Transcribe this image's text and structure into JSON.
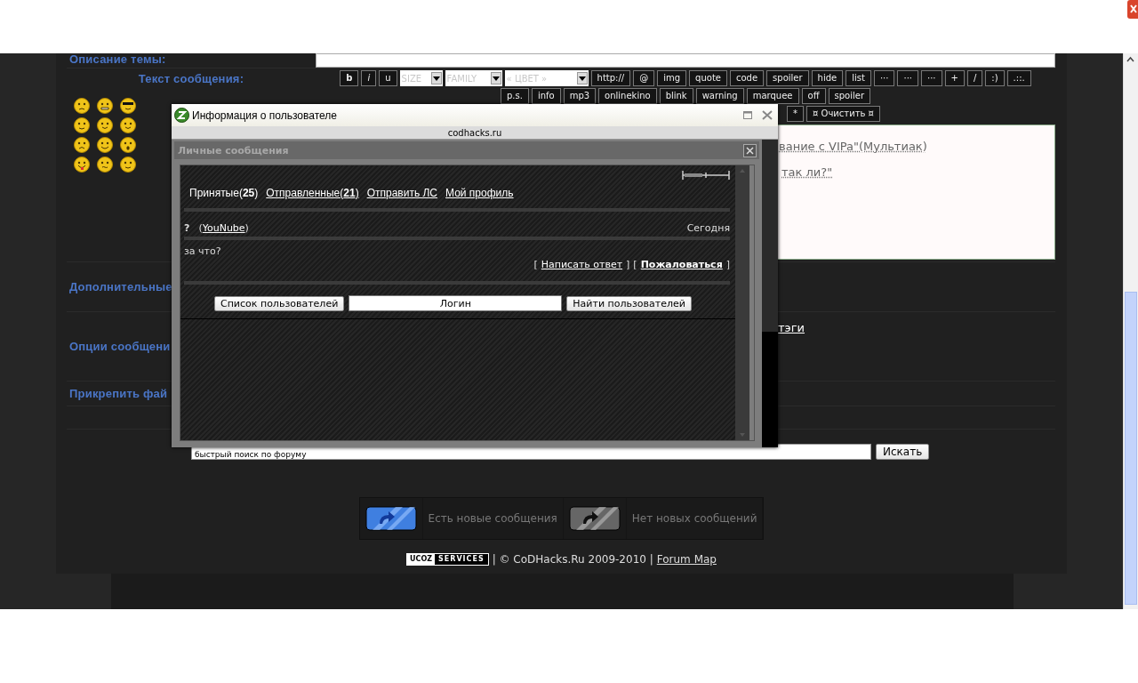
{
  "topic_description": {
    "label": "Описание темы:"
  },
  "message": {
    "label": "Текст сообщения:",
    "smileys": [
      {
        "kind": "angry"
      },
      {
        "kind": "grin"
      },
      {
        "kind": "cool"
      },
      {
        "kind": "eyes"
      },
      {
        "kind": "content"
      },
      {
        "kind": "content"
      },
      {
        "kind": "sad"
      },
      {
        "kind": "smile"
      },
      {
        "kind": "shock"
      },
      {
        "kind": "tongue"
      },
      {
        "kind": "dizzy"
      },
      {
        "kind": "wink"
      }
    ]
  },
  "toolbar": {
    "rows": [
      {
        "items": [
          {
            "kind": "bold",
            "label": "b"
          },
          {
            "kind": "italic",
            "label": "i"
          },
          {
            "kind": "button",
            "label": "u"
          },
          {
            "kind": "select",
            "label": "SIZE"
          },
          {
            "kind": "select",
            "label": "FAMILY"
          },
          {
            "kind": "select",
            "label": "« ЦВЕТ »"
          },
          {
            "kind": "button",
            "label": "http://"
          },
          {
            "kind": "button",
            "label": "@"
          },
          {
            "kind": "button",
            "label": "img"
          },
          {
            "kind": "button",
            "label": "quote"
          },
          {
            "kind": "button",
            "label": "code"
          },
          {
            "kind": "button",
            "label": "spoiler"
          },
          {
            "kind": "button",
            "label": "hide"
          },
          {
            "kind": "button",
            "label": "list"
          },
          {
            "kind": "button",
            "label": "···"
          },
          {
            "kind": "button",
            "label": "···"
          },
          {
            "kind": "button",
            "label": "···"
          },
          {
            "kind": "button",
            "label": "+"
          },
          {
            "kind": "button",
            "label": "/"
          },
          {
            "kind": "button",
            "label": ":)"
          },
          {
            "kind": "button",
            "label": ".::."
          }
        ]
      },
      {
        "items": [
          {
            "kind": "button",
            "label": "p.s."
          },
          {
            "kind": "button",
            "label": "info"
          },
          {
            "kind": "button",
            "label": "mp3"
          },
          {
            "kind": "button",
            "label": "onlinekino"
          },
          {
            "kind": "button",
            "label": "blink"
          },
          {
            "kind": "button",
            "label": "warning"
          },
          {
            "kind": "button",
            "label": "marquee"
          },
          {
            "kind": "button",
            "label": "off"
          },
          {
            "kind": "button",
            "label": "spoiler"
          }
        ]
      },
      {
        "items": [
          {
            "kind": "button",
            "label": "*"
          },
          {
            "kind": "button",
            "label": "¤ Очистить ¤"
          }
        ]
      }
    ]
  },
  "editor": {
    "lines": [
      "вание с VIPa\"(Мультиак)",
      "так ли?\""
    ]
  },
  "sections": [
    {
      "label": "Дополнительные"
    },
    {
      "label": "Опции сообщени",
      "link": "тэги"
    },
    {
      "label": "Прикрепить фай"
    }
  ],
  "search": {
    "value": "быстрый поиск по форуму",
    "button": "Искать"
  },
  "legend": [
    {
      "kind": "new",
      "label": "Есть новые сообщения"
    },
    {
      "kind": "none",
      "label": "Нет новых сообщений"
    }
  ],
  "footer": {
    "badge_left": "UCOZ",
    "badge_right": "SERVICES",
    "text": "| © CoDHacks.Ru 2009-2010 |",
    "link": "Forum Map"
  },
  "popup": {
    "title": "Информация о пользователе",
    "site": "codhacks.ru",
    "panel_title": "Личные сообщения",
    "tabs": [
      {
        "label": "Принятые(**25**)",
        "selected": true
      },
      {
        "label": "Отправленные(**21**)",
        "selected": false
      },
      {
        "label": "Отправить ЛС",
        "selected": false
      },
      {
        "label": "Мой профиль",
        "selected": false
      }
    ],
    "message": {
      "mark": "?",
      "sender": {
        "open": "(",
        "name": "YouNube",
        "close": ")"
      },
      "date": "Сегодня",
      "body": "за что?",
      "actions": [
        {
          "open": "[",
          "label": "Написать ответ",
          "close": "]",
          "bold": false
        },
        {
          "open": "[",
          "label": "Пожаловаться",
          "close": "]",
          "bold": true
        }
      ]
    },
    "user_list_button": "Список пользователей",
    "login_field": {
      "value": "Логин"
    },
    "find_button": "Найти пользователей"
  }
}
